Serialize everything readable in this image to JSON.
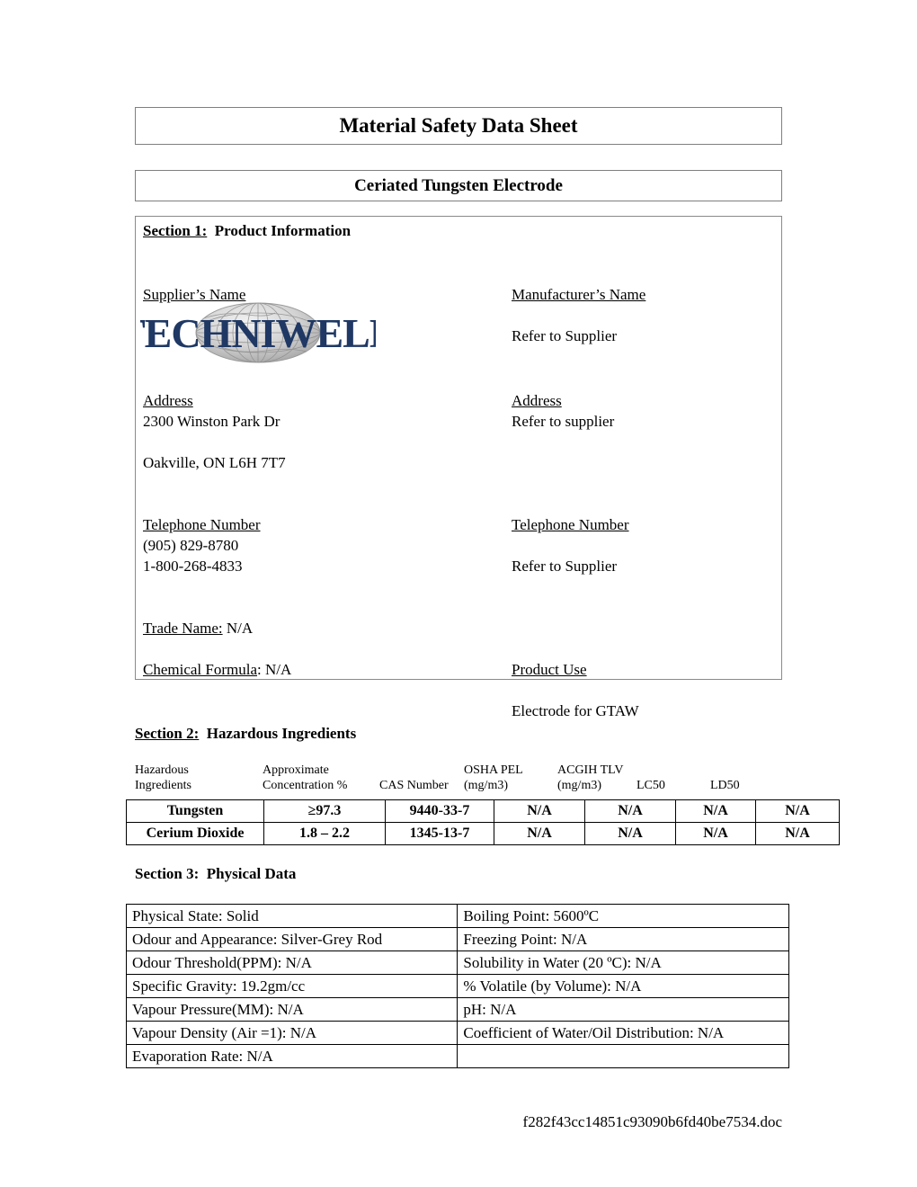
{
  "document": {
    "title": "Material Safety Data Sheet",
    "product_title": "Ceriated Tungsten Electrode",
    "footer_filename": "f282f43cc14851c93090b6fd40be7534.doc"
  },
  "section1": {
    "number": "Section 1:",
    "name": "Product Information",
    "supplier": {
      "name_label": "Supplier’s Name",
      "logo_text": "TECHNIWELD",
      "address_label": "Address",
      "address_line1": "2300 Winston Park Dr",
      "address_line2": "Oakville, ON  L6H 7T7",
      "telephone_label": "Telephone Number",
      "telephone_1": "(905) 829-8780",
      "telephone_2": "1-800-268-4833"
    },
    "manufacturer": {
      "name_label": "Manufacturer’s Name",
      "name_value": "Refer to Supplier",
      "address_label": "Address",
      "address_value": "Refer to supplier",
      "telephone_label": "Telephone Number",
      "telephone_value": "Refer to Supplier"
    },
    "trade_name_label": "Trade Name:",
    "trade_name_value": "N/A",
    "chemical_formula_label": "Chemical Formula",
    "chemical_formula_value": ": N/A",
    "product_use_label": "Product Use",
    "product_use_value": "Electrode for GTAW"
  },
  "section2": {
    "number": "Section 2:",
    "name": "Hazardous Ingredients",
    "column_headers": [
      "Hazardous\nIngredients",
      "Approximate\nConcentration %",
      "CAS Number",
      "OSHA PEL\n(mg/m3)",
      "ACGIH TLV\n(mg/m3)",
      "LC50",
      "LD50"
    ],
    "rows": [
      {
        "ingredient": "Tungsten",
        "concentration": "≥97.3",
        "cas_number": "9440-33-7",
        "osha_pel": "N/A",
        "acgih_tlv": "N/A",
        "lc50": "N/A",
        "ld50": "N/A"
      },
      {
        "ingredient": "Cerium Dioxide",
        "concentration": "1.8 – 2.2",
        "cas_number": "1345-13-7",
        "osha_pel": "N/A",
        "acgih_tlv": "N/A",
        "lc50": "N/A",
        "ld50": "N/A"
      }
    ]
  },
  "section3": {
    "number": "Section 3:",
    "name": "Physical Data",
    "rows": [
      {
        "left": "Physical State: Solid",
        "right": "Boiling Point:  5600ºC"
      },
      {
        "left": "Odour and Appearance: Silver-Grey Rod",
        "right": "Freezing Point:  N/A"
      },
      {
        "left": "Odour Threshold(PPM): N/A",
        "right": "Solubility in Water (20 ºC):  N/A"
      },
      {
        "left": "Specific Gravity:  19.2gm/cc",
        "right": "% Volatile (by Volume): N/A"
      },
      {
        "left": "Vapour Pressure(MM):  N/A",
        "right": "pH:  N/A"
      },
      {
        "left": "Vapour Density (Air =1):  N/A",
        "right": "Coefficient of Water/Oil Distribution:  N/A"
      },
      {
        "left": "Evaporation Rate:  N/A",
        "right": ""
      }
    ]
  },
  "colors": {
    "logo_navy": "#1F3864",
    "logo_globe_grey": "#BFBFBF",
    "border_grey": "#7f7f7f",
    "border_black": "#000000",
    "text": "#000000"
  }
}
